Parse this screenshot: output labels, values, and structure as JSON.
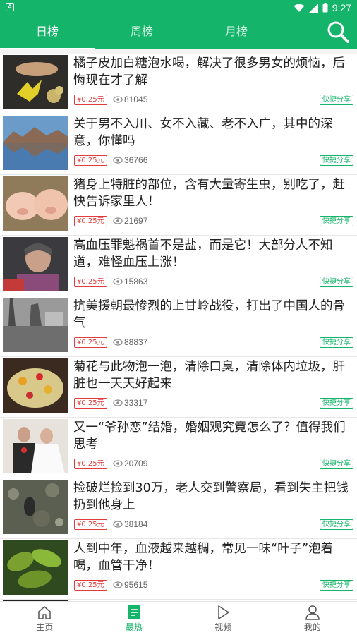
{
  "status_bar": {
    "time": "9:27",
    "left_icon": "A"
  },
  "header": {
    "tabs": [
      {
        "label": "日榜",
        "active": true
      },
      {
        "label": "周榜",
        "active": false
      },
      {
        "label": "月榜",
        "active": false
      }
    ],
    "search_icon": "search-icon"
  },
  "colors": {
    "accent": "#14b46a",
    "price": "#e23b3b",
    "text": "#222222"
  },
  "articles": [
    {
      "title": "橘子皮加白糖泡水喝，解决了很多男女的烦恼，后悔现在才了解",
      "price": "¥0.25元",
      "views": "81045",
      "share": "快捷分享"
    },
    {
      "title": "关于男不入川、女不入藏、老不入广，其中的深意，你懂吗",
      "price": "¥0.25元",
      "views": "36766",
      "share": "快捷分享"
    },
    {
      "title": "猪身上特脏的部位，含有大量寄生虫，别吃了，赶快告诉家里人！",
      "price": "¥0.25元",
      "views": "21697",
      "share": "快捷分享"
    },
    {
      "title": "高血压罪魁祸首不是盐，而是它！大部分人不知道，难怪血压上涨！",
      "price": "¥0.25元",
      "views": "15863",
      "share": "快捷分享"
    },
    {
      "title": "抗美援朝最惨烈的上甘岭战役，打出了中国人的骨气",
      "price": "¥0.25元",
      "views": "88837",
      "share": "快捷分享"
    },
    {
      "title": "菊花与此物泡一泡，清除口臭，清除体内垃圾，肝脏也一天天好起来",
      "price": "¥0.25元",
      "views": "33317",
      "share": "快捷分享"
    },
    {
      "title": "又一“爷孙恋”结婚，婚姻观究竟怎么了？值得我们思考",
      "price": "¥0.25元",
      "views": "20709",
      "share": "快捷分享"
    },
    {
      "title": "捡破烂捡到30万，老人交到警察局，看到失主把钱扔到他身上",
      "price": "¥0.25元",
      "views": "38184",
      "share": "快捷分享"
    },
    {
      "title": "人到中年，血液越来越稠，常见一味“叶子”泡着喝，血管干净！",
      "price": "¥0.25元",
      "views": "95615",
      "share": "快捷分享"
    }
  ],
  "bottom_nav": [
    {
      "label": "主页",
      "icon": "home-icon",
      "active": false
    },
    {
      "label": "最热",
      "icon": "hot-list-icon",
      "active": true
    },
    {
      "label": "视频",
      "icon": "play-icon",
      "active": false
    },
    {
      "label": "我的",
      "icon": "user-icon",
      "active": false
    }
  ]
}
